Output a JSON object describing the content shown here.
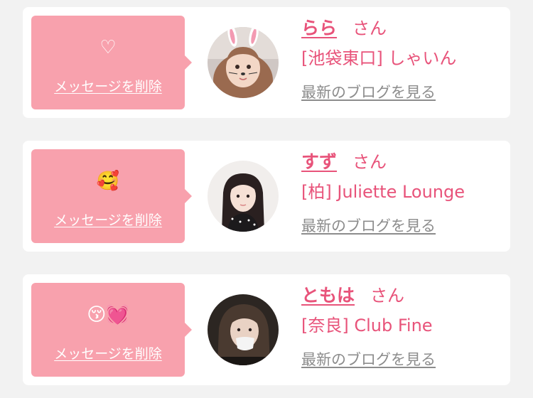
{
  "messages": [
    {
      "message": "♡",
      "delete_label": "メッセージを削除",
      "avatar_icon": "bunny-filter-photo",
      "name": "らら",
      "honorific": "さん",
      "shop": "[池袋東口] しゃいん",
      "blog_label": "最新のブログを見る"
    },
    {
      "message": "🥰",
      "delete_label": "メッセージを削除",
      "avatar_icon": "profile-photo",
      "name": "すず",
      "honorific": "さん",
      "shop": "[柏] Juliette Lounge",
      "blog_label": "最新のブログを見る"
    },
    {
      "message": "😚💓",
      "delete_label": "メッセージを削除",
      "avatar_icon": "profile-photo",
      "name": "ともは",
      "honorific": "さん",
      "shop": "[奈良] Club Fine",
      "blog_label": "最新のブログを見る"
    }
  ],
  "colors": {
    "background": "#f2f2f2",
    "card": "#ffffff",
    "bubble": "#f8a1ad",
    "accent": "#e8537a",
    "link_gray": "#8c8c8c"
  }
}
